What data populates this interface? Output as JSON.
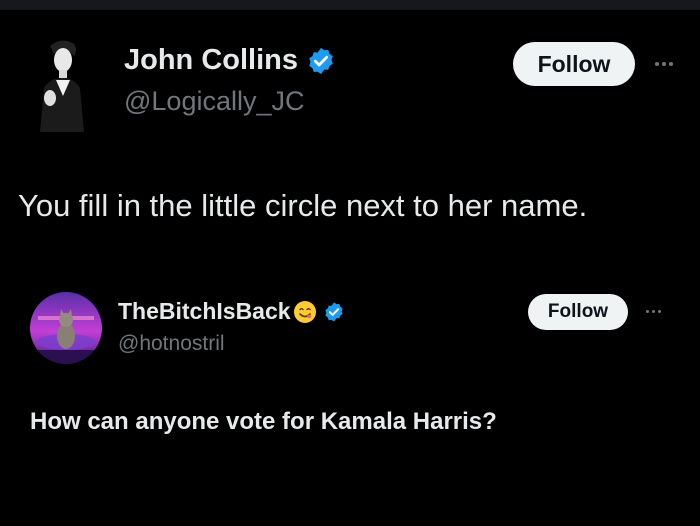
{
  "colors": {
    "background": "#000000",
    "text": "#e7e9ea",
    "secondary_text": "#71767b",
    "button_bg": "#eff3f4",
    "verified_blue": "#1d9bf0"
  },
  "main_post": {
    "author_name": "John Collins",
    "handle": "@Logically_JC",
    "follow_label": "Follow",
    "text": "You fill in the little circle next to her name.",
    "icons": {
      "verified": "verified-badge-icon",
      "more": "more-options-icon"
    }
  },
  "quoted_post": {
    "author_name": "TheBitchIsBack",
    "handle": "@hotnostril",
    "follow_label": "Follow",
    "text": "How can anyone vote for Kamala Harris?",
    "icons": {
      "emoji": "smiling-face-emoji-icon",
      "verified": "verified-badge-icon",
      "more": "more-options-icon"
    }
  }
}
